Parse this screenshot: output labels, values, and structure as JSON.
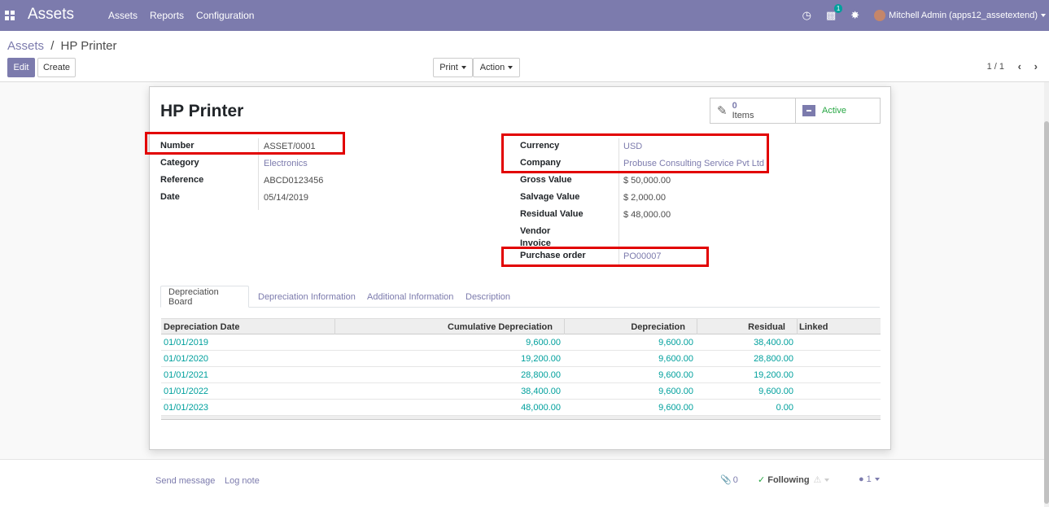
{
  "navbar": {
    "brand": "Assets",
    "menu": [
      "Assets",
      "Reports",
      "Configuration"
    ],
    "chat_badge": "1",
    "user": "Mitchell Admin (apps12_assetextend)"
  },
  "control": {
    "breadcrumb_parent": "Assets",
    "breadcrumb_sep": "/",
    "breadcrumb_current": "HP Printer",
    "edit_label": "Edit",
    "create_label": "Create",
    "print_label": "Print",
    "action_label": "Action",
    "pager": "1 / 1"
  },
  "form": {
    "title": "HP Printer",
    "items_count": "0",
    "items_label": "Items",
    "active_label": "Active",
    "left_fields": [
      {
        "label": "Number",
        "value": "ASSET/0001"
      },
      {
        "label": "Category",
        "value": "Electronics"
      },
      {
        "label": "Reference",
        "value": "ABCD0123456"
      },
      {
        "label": "Date",
        "value": "05/14/2019"
      }
    ],
    "right_fields": [
      {
        "label": "Currency",
        "value": "USD"
      },
      {
        "label": "Company",
        "value": "Probuse Consulting Service Pvt Ltd"
      },
      {
        "label": "Gross Value",
        "value": "$ 50,000.00"
      },
      {
        "label": "Salvage Value",
        "value": "$ 2,000.00"
      },
      {
        "label": "Residual Value",
        "value": "$ 48,000.00"
      },
      {
        "label": "Vendor",
        "value": ""
      },
      {
        "label": "Invoice",
        "value": ""
      },
      {
        "label": "Purchase order",
        "value": "PO00007"
      }
    ]
  },
  "tabs": [
    "Depreciation Board",
    "Depreciation Information",
    "Additional Information",
    "Description"
  ],
  "table": {
    "headers": [
      "Depreciation Date",
      "Cumulative Depreciation",
      "Depreciation",
      "Residual",
      "Linked"
    ],
    "rows": [
      [
        "01/01/2019",
        "9,600.00",
        "9,600.00",
        "38,400.00"
      ],
      [
        "01/01/2020",
        "19,200.00",
        "9,600.00",
        "28,800.00"
      ],
      [
        "01/01/2021",
        "28,800.00",
        "9,600.00",
        "19,200.00"
      ],
      [
        "01/01/2022",
        "38,400.00",
        "9,600.00",
        "9,600.00"
      ],
      [
        "01/01/2023",
        "48,000.00",
        "9,600.00",
        "0.00"
      ]
    ]
  },
  "chatter": {
    "send_message": "Send message",
    "log_note": "Log note",
    "attachments": "0",
    "following": "Following",
    "followers": "1"
  },
  "colors": {
    "brand": "#7c7bad",
    "link": "#00a09d",
    "highlight": "#e20000"
  }
}
